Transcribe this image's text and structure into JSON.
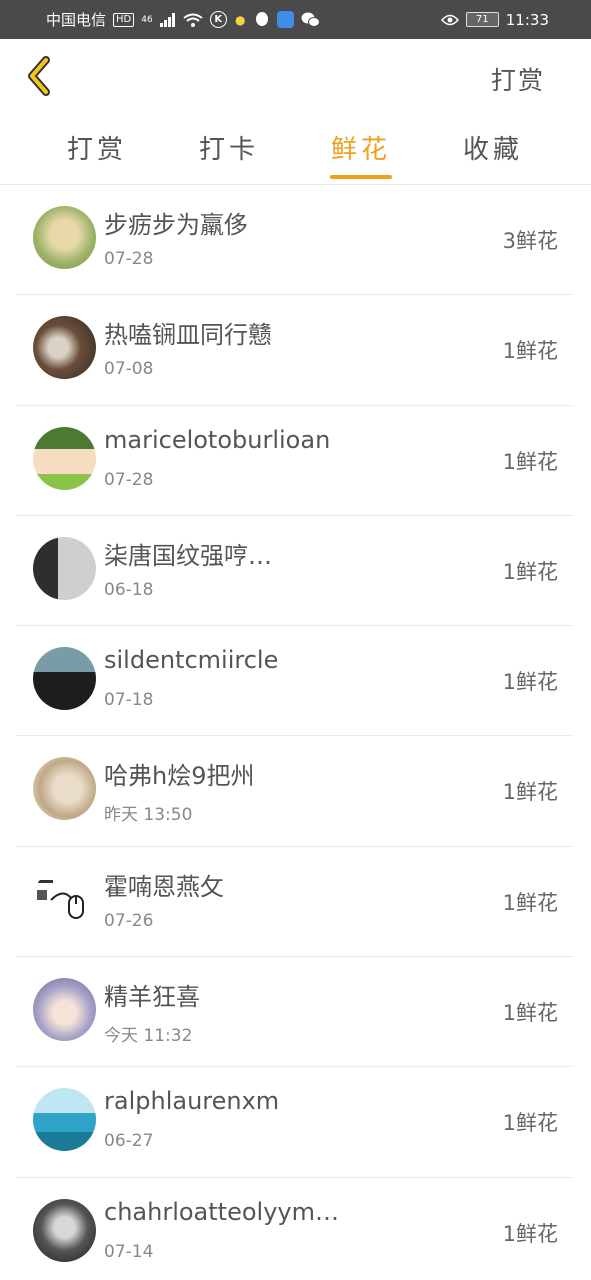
{
  "status_bar": {
    "carrier": "中国电信",
    "hd": "HD",
    "network": "46",
    "battery": "71",
    "time": "11:33"
  },
  "header": {
    "action_label": "打赏"
  },
  "tabs": [
    {
      "label": "打赏",
      "active": false
    },
    {
      "label": "打卡",
      "active": false
    },
    {
      "label": "鲜花",
      "active": true
    },
    {
      "label": "收藏",
      "active": false
    }
  ],
  "accent_color": "#f0a020",
  "items": [
    {
      "name": "步疬步为羸侈",
      "date": "07-28",
      "count": "3鲜花",
      "avatar_color": "#b8c487"
    },
    {
      "name": "热嗑锎皿同行戆",
      "date": "07-08",
      "count": "1鲜花",
      "avatar_color": "#5c4a3e"
    },
    {
      "name": "maricelotoburlioan",
      "date": "07-28",
      "count": "1鲜花",
      "avatar_color": "#6aa84f"
    },
    {
      "name": "柒唐国纹强哼…",
      "date": "06-18",
      "count": "1鲜花",
      "avatar_color": "#9e9e9e"
    },
    {
      "name": "sildentcmiircle",
      "date": "07-18",
      "count": "1鲜花",
      "avatar_color": "#3a3a3a"
    },
    {
      "name": "哈弗h烩9把州",
      "date": "昨天  13:50",
      "count": "1鲜花",
      "avatar_color": "#c9b79a"
    },
    {
      "name": "霍喃恩燕攵",
      "date": "07-26",
      "count": "1鲜花",
      "avatar_color": "#ffffff"
    },
    {
      "name": "精羊狂喜",
      "date": "今天  11:32",
      "count": "1鲜花",
      "avatar_color": "#a9a3c9"
    },
    {
      "name": "ralphlaurenxm",
      "date": "06-27",
      "count": "1鲜花",
      "avatar_color": "#3fa9c9"
    },
    {
      "name": "chahrloatteolyym…",
      "date": "07-14",
      "count": "1鲜花",
      "avatar_color": "#4a4a4a"
    }
  ]
}
